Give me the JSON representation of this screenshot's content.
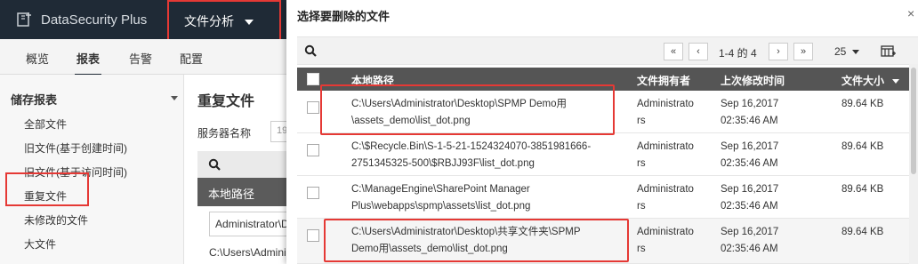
{
  "app": {
    "name": "DataSecurity Plus"
  },
  "top_menu": {
    "label": "文件分析"
  },
  "tabs": [
    "概览",
    "报表",
    "告警",
    "配置"
  ],
  "sidebar": {
    "title": "储存报表",
    "items": [
      "全部文件",
      "旧文件(基于创建时间)",
      "旧文件(基于访问时间)",
      "重复文件",
      "未修改的文件",
      "大文件"
    ]
  },
  "content": {
    "title": "重复文件",
    "server_label": "服务器名称",
    "server_value": "19",
    "column_header": "本地路径",
    "filter_value": "Administrator\\D",
    "row_text": "C:\\Users\\Admini"
  },
  "dialog": {
    "title": "选择要删除的文件",
    "pagination": {
      "first": "«",
      "prev": "‹",
      "range": "1-4 的 4",
      "next": "›",
      "last": "»"
    },
    "per_page": "25",
    "columns": {
      "path": "本地路径",
      "owner": "文件拥有者",
      "modified": "上次修改时间",
      "size": "文件大小"
    },
    "rows": [
      {
        "path1": "C:\\Users\\Administrator\\Desktop\\SPMP Demo用",
        "path2": "\\assets_demo\\list_dot.png",
        "owner1": "Administrato",
        "owner2": "rs",
        "date1": "Sep 16,2017",
        "date2": "02:35:46 AM",
        "size": "89.64 KB"
      },
      {
        "path1": "C:\\$Recycle.Bin\\S-1-5-21-1524324070-3851981666-",
        "path2": "2751345325-500\\$RBJJ93F\\list_dot.png",
        "owner1": "Administrato",
        "owner2": "rs",
        "date1": "Sep 16,2017",
        "date2": "02:35:46 AM",
        "size": "89.64 KB"
      },
      {
        "path1": "C:\\ManageEngine\\SharePoint Manager",
        "path2": "Plus\\webapps\\spmp\\assets\\list_dot.png",
        "owner1": "Administrato",
        "owner2": "rs",
        "date1": "Sep 16,2017",
        "date2": "02:35:46 AM",
        "size": "89.64 KB"
      },
      {
        "path1": "C:\\Users\\Administrator\\Desktop\\共享文件夹\\SPMP",
        "path2": "Demo用\\assets_demo\\list_dot.png",
        "owner1": "Administrato",
        "owner2": "rs",
        "date1": "Sep 16,2017",
        "date2": "02:35:46 AM",
        "size": "89.64 KB"
      }
    ]
  },
  "colors": {
    "topbar": "#1f2a36",
    "highlight": "#e53935",
    "table_header": "#555555"
  }
}
